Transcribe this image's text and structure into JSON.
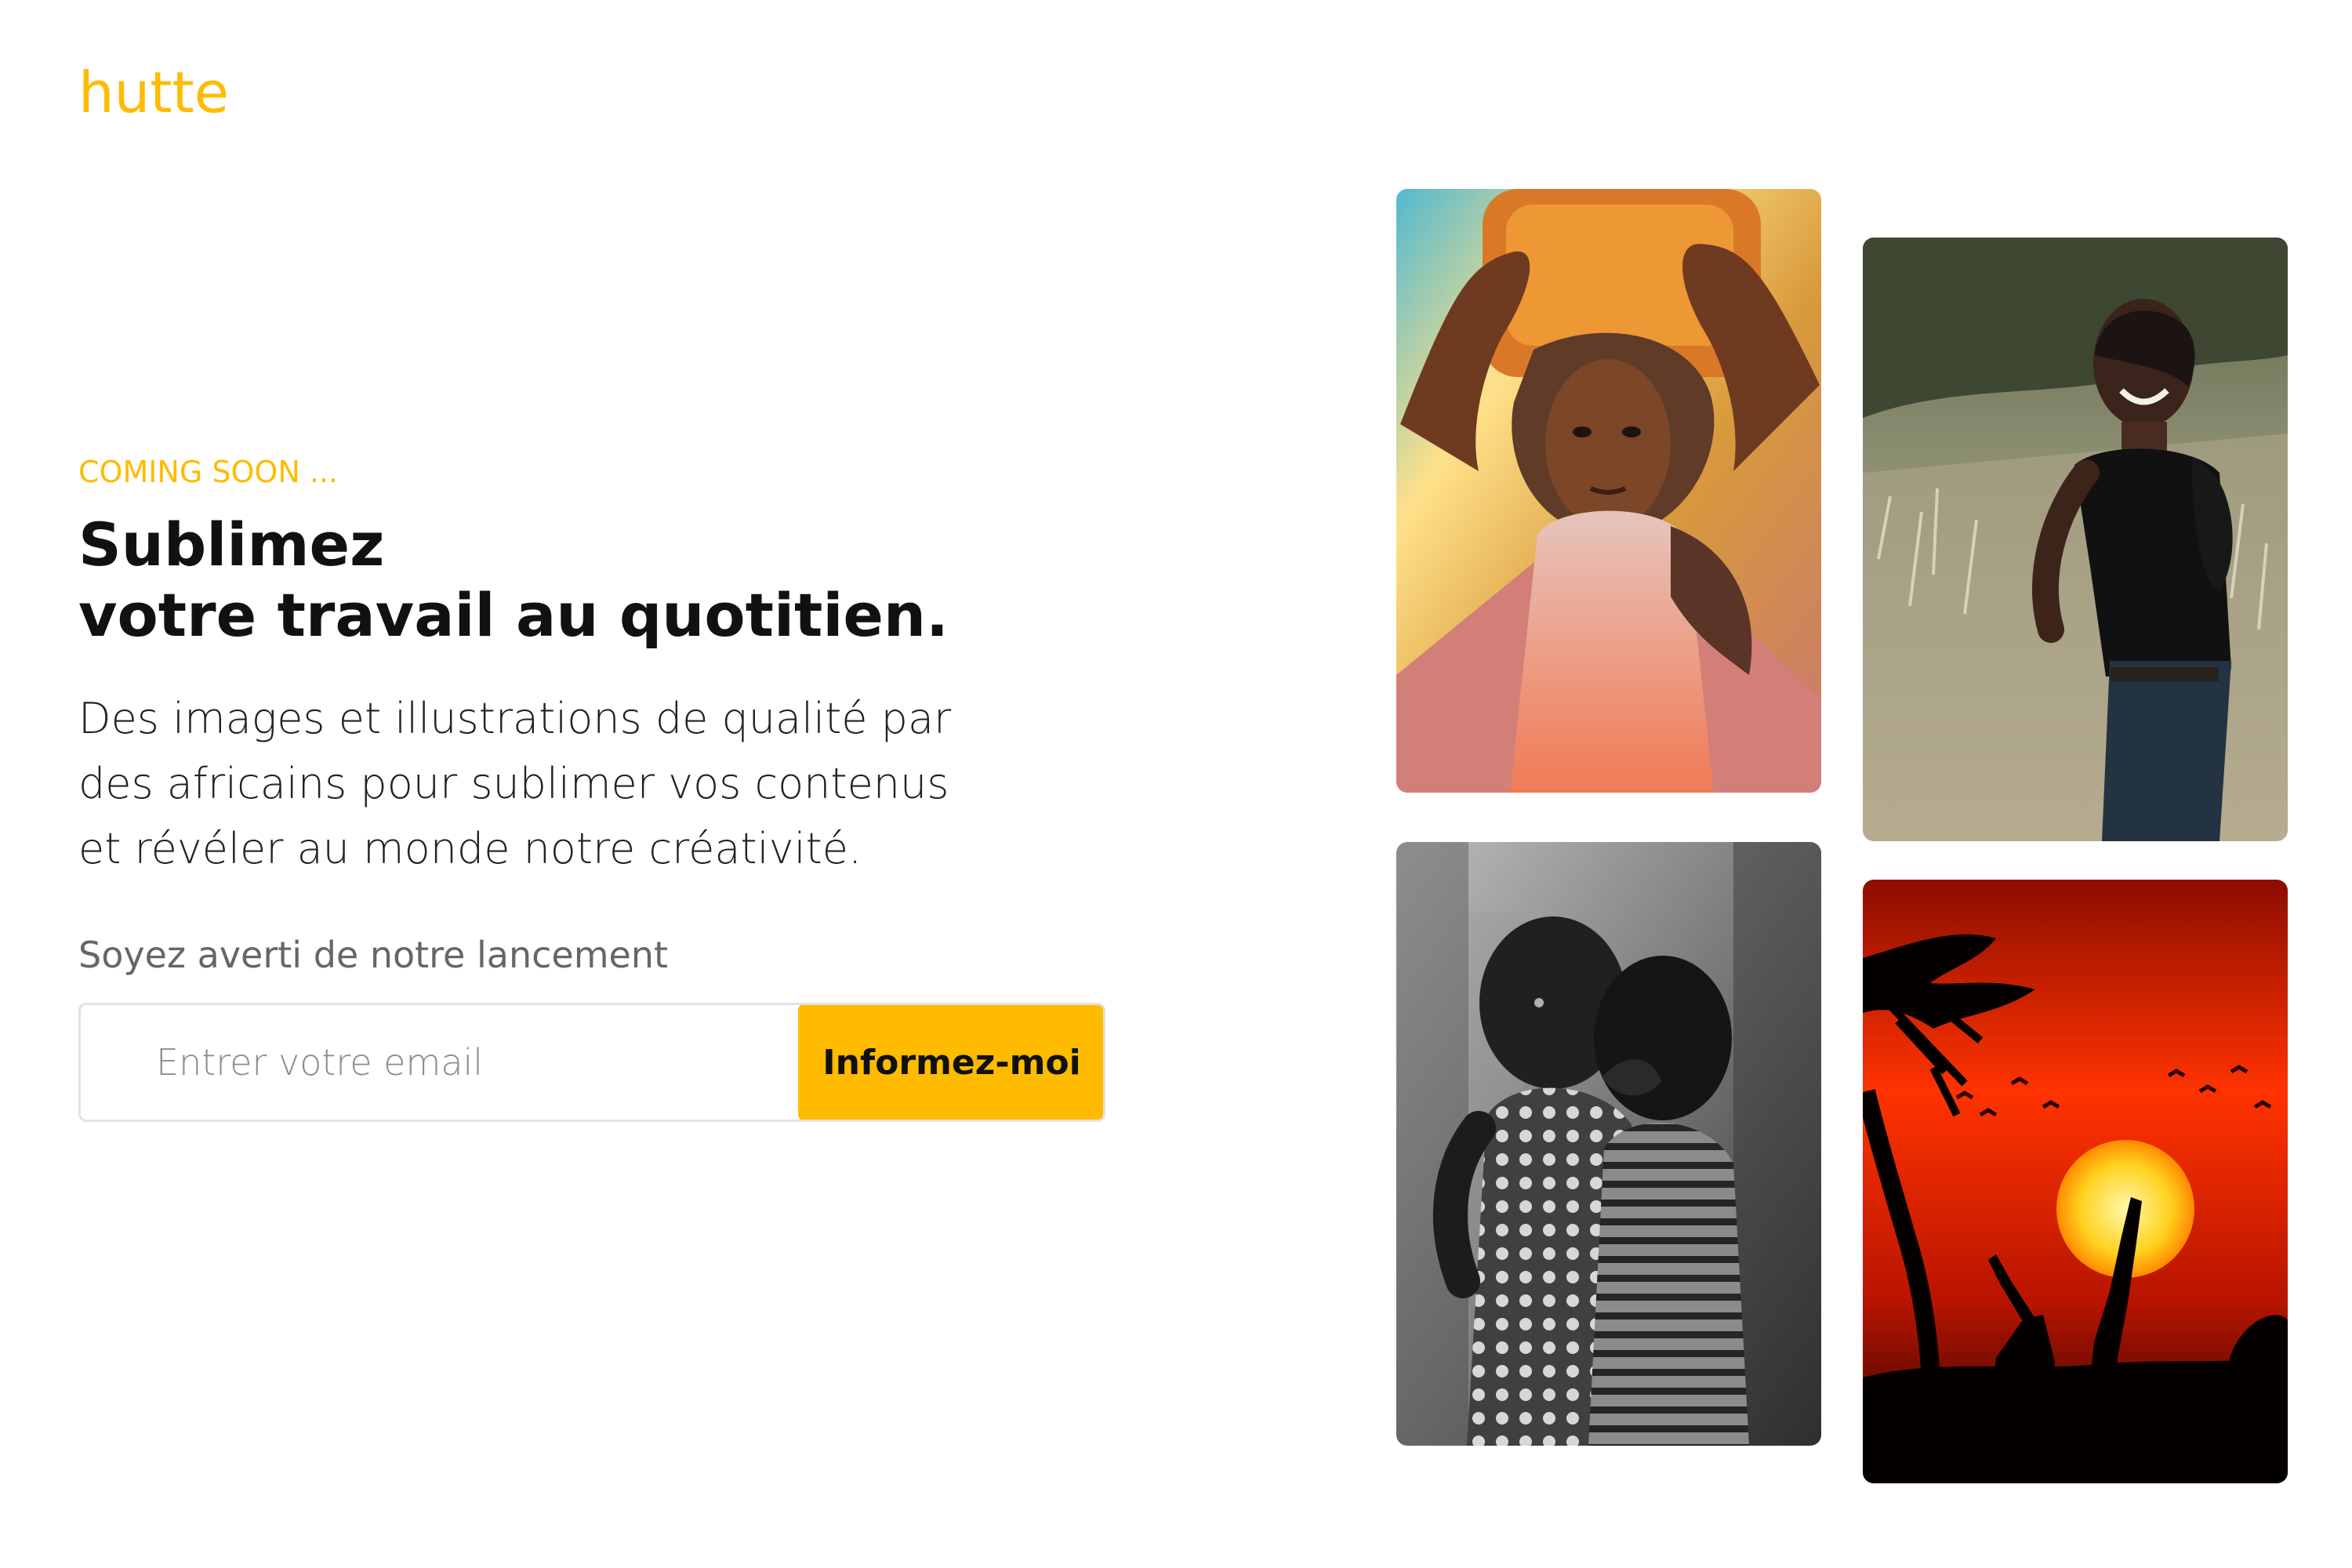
{
  "brand": {
    "name": "hutte",
    "accent_color": "#ffbb00"
  },
  "hero": {
    "kicker": "COMING SOON ...",
    "headline_line1": "Sublimez",
    "headline_line2": "votre travail au quotitien.",
    "description": "Des images et illustrations de qualité par des africains pour sublimer vos contenus et révéler au monde notre créativité."
  },
  "signup": {
    "label": "Soyez averti de notre lancement",
    "email_placeholder": "Entrer votre email",
    "email_value": "",
    "button_label": "Informez-moi"
  },
  "gallery": [
    {
      "subject": "child carrying a jerrycan on a road"
    },
    {
      "subject": "smiling woman in a grass field"
    },
    {
      "subject": "two children whispering in black and white"
    },
    {
      "subject": "giraffes and acacia tree at sunset"
    }
  ]
}
